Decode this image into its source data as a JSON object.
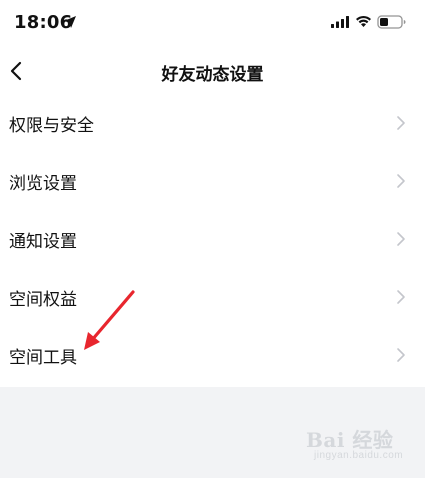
{
  "status_bar": {
    "time": "18:06",
    "icons": [
      "location-arrow-icon",
      "signal-icon",
      "wifi-icon",
      "battery-icon"
    ]
  },
  "nav": {
    "title": "好友动态设置",
    "back_icon": "chevron-left-icon"
  },
  "menu": {
    "items": [
      {
        "label": "权限与安全"
      },
      {
        "label": "浏览设置"
      },
      {
        "label": "通知设置"
      },
      {
        "label": "空间权益"
      },
      {
        "label": "空间工具"
      }
    ],
    "chevron_icon": "chevron-right-icon"
  },
  "annotation": {
    "type": "red-arrow",
    "color": "#e8262e",
    "points_to": "空间工具"
  },
  "watermark": {
    "text": "Bai 经验",
    "subtext": "jingyan.baidu.com"
  },
  "colors": {
    "page_background": "#f2f3f5",
    "panel_background": "#ffffff",
    "text": "#111111",
    "chevron": "#c4c6cc"
  }
}
